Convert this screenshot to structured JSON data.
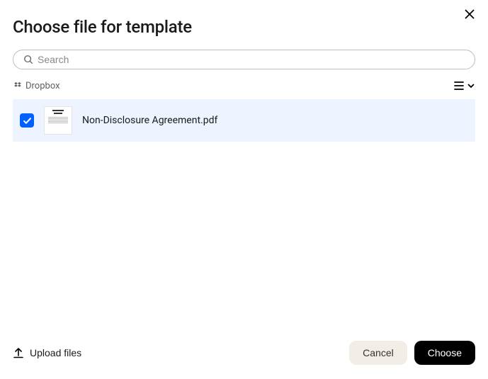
{
  "title": "Choose file for template",
  "search": {
    "placeholder": "Search",
    "value": ""
  },
  "breadcrumb": {
    "label": "Dropbox"
  },
  "files": [
    {
      "name": "Non-Disclosure Agreement.pdf",
      "selected": true
    }
  ],
  "footer": {
    "upload_label": "Upload files",
    "cancel_label": "Cancel",
    "choose_label": "Choose"
  }
}
